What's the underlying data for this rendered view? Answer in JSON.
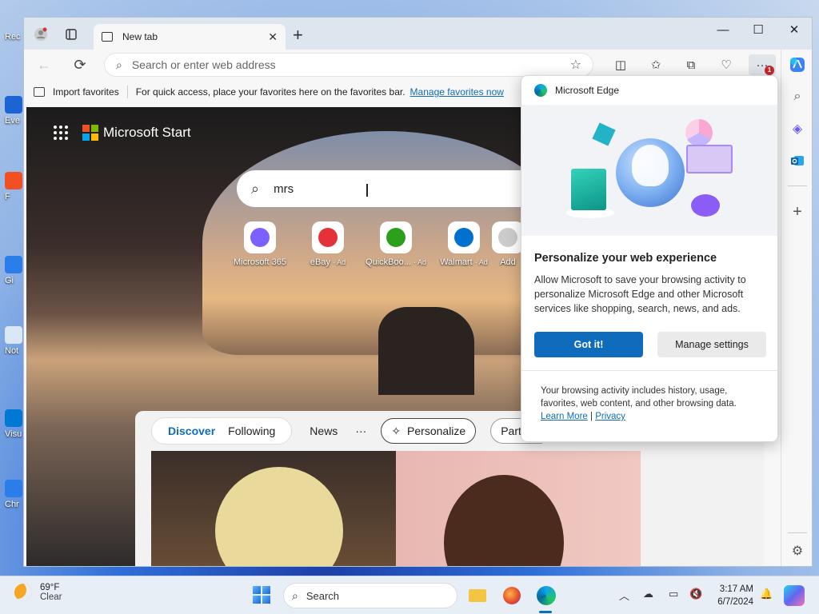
{
  "desktop": {
    "icons": [
      {
        "label": "Rec"
      },
      {
        "label": "Eve"
      },
      {
        "label": "F"
      },
      {
        "label": "Gi"
      },
      {
        "label": "Not"
      },
      {
        "label": "Visu"
      },
      {
        "label": "Chr"
      }
    ]
  },
  "browser": {
    "tab": {
      "label": "New tab"
    },
    "address": {
      "placeholder": "Search or enter web address"
    },
    "more_badge": "1",
    "favorites_bar": {
      "import_label": "Import favorites",
      "hint": "For quick access, place your favorites here on the favorites bar.",
      "manage_link": "Manage favorites now"
    }
  },
  "page": {
    "brand": "Microsoft Start",
    "search_value": "mrs",
    "quick_links": [
      {
        "label": "Microsoft 365",
        "ad": "",
        "color": "#7b61ff"
      },
      {
        "label": "eBay",
        "ad": "· Ad",
        "color": "#e53238"
      },
      {
        "label": "QuickBoo...",
        "ad": "· Ad",
        "color": "#2ca01c"
      },
      {
        "label": "Walmart",
        "ad": "· Ad",
        "color": "#0071ce"
      },
      {
        "label": "Add",
        "ad": "",
        "color": "#cccccc"
      }
    ],
    "feed_tabs": {
      "discover": "Discover",
      "following": "Following",
      "news": "News",
      "more": "···",
      "personalize": "Personalize",
      "partial": "Partial"
    }
  },
  "popup": {
    "header": "Microsoft Edge",
    "title": "Personalize your web experience",
    "body": "Allow Microsoft to save your browsing activity to personalize Microsoft Edge and other Microsoft services like shopping, search, news, and ads.",
    "primary_button": "Got it!",
    "secondary_button": "Manage settings",
    "footer": "Your browsing activity includes history, usage, favorites, web content, and other browsing data.",
    "learn_more": "Learn More",
    "separator": "|",
    "privacy": "Privacy"
  },
  "taskbar": {
    "weather_temp": "69°F",
    "weather_cond": "Clear",
    "search_label": "Search",
    "time": "3:17 AM",
    "date": "6/7/2024"
  },
  "colors": {
    "accent": "#0f6cbd",
    "badge": "#c4262e"
  }
}
